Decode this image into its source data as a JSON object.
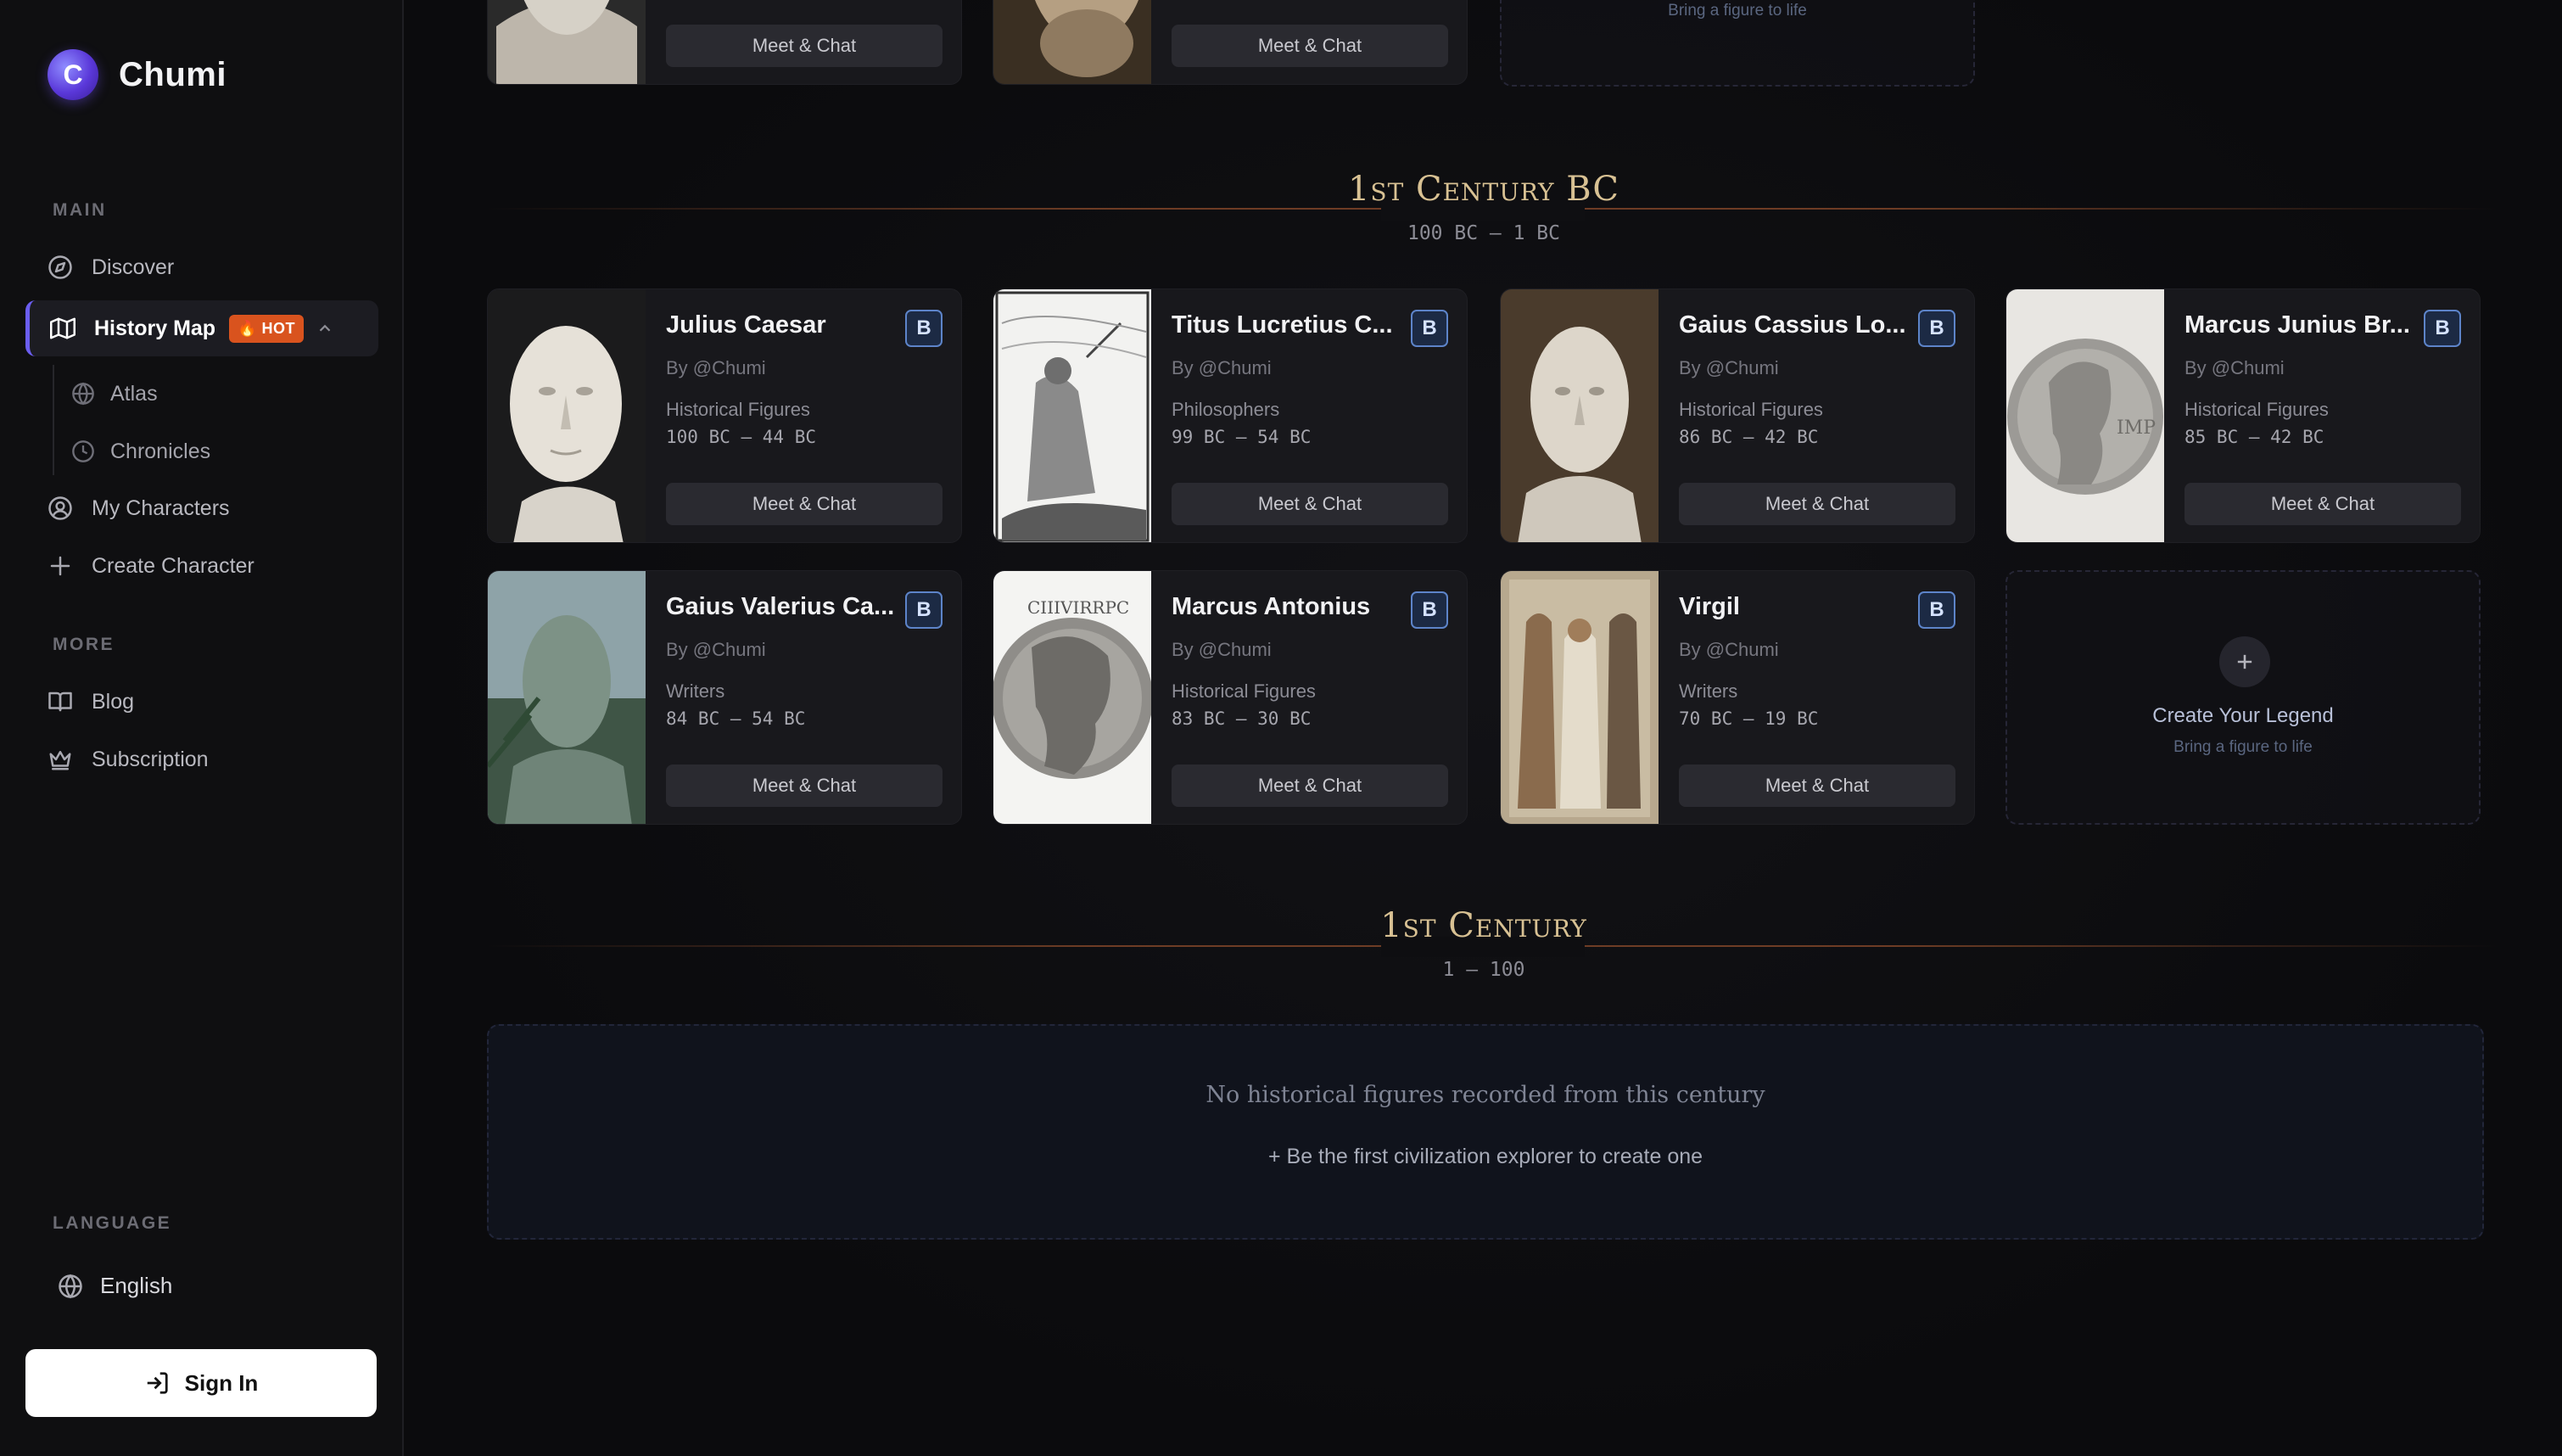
{
  "app": {
    "name": "Chumi",
    "logo_letter": "C",
    "accent": "#6b5ef0"
  },
  "sidebar": {
    "main_label": "MAIN",
    "discover": "Discover",
    "history_map": "History Map",
    "hot_badge": "🔥 HOT",
    "atlas": "Atlas",
    "chronicles": "Chronicles",
    "my_characters": "My Characters",
    "create_character": "Create Character",
    "more_label": "MORE",
    "blog": "Blog",
    "subscription": "Subscription",
    "language_label": "LANGUAGE",
    "language_value": "English",
    "sign_in": "Sign In"
  },
  "top_partial": {
    "cards": [
      {
        "button": "Meet & Chat"
      },
      {
        "button": "Meet & Chat"
      }
    ],
    "legend_sub": "Bring a figure to life"
  },
  "sections": [
    {
      "title": "1st Century BC",
      "range": "100 BC — 1 BC",
      "characters": [
        {
          "name": "Julius Caesar",
          "badge": "B",
          "author": "By @Chumi",
          "category": "Historical Figures",
          "dates": "100 BC — 44 BC",
          "button": "Meet & Chat"
        },
        {
          "name": "Titus Lucretius C...",
          "badge": "B",
          "author": "By @Chumi",
          "category": "Philosophers",
          "dates": "99 BC — 54 BC",
          "button": "Meet & Chat"
        },
        {
          "name": "Gaius Cassius Lo...",
          "badge": "B",
          "author": "By @Chumi",
          "category": "Historical Figures",
          "dates": "86 BC — 42 BC",
          "button": "Meet & Chat"
        },
        {
          "name": "Marcus Junius Br...",
          "badge": "B",
          "author": "By @Chumi",
          "category": "Historical Figures",
          "dates": "85 BC — 42 BC",
          "button": "Meet & Chat"
        },
        {
          "name": "Gaius Valerius Ca...",
          "badge": "B",
          "author": "By @Chumi",
          "category": "Writers",
          "dates": "84 BC — 54 BC",
          "button": "Meet & Chat"
        },
        {
          "name": "Marcus Antonius",
          "badge": "B",
          "author": "By @Chumi",
          "category": "Historical Figures",
          "dates": "83 BC — 30 BC",
          "button": "Meet & Chat"
        },
        {
          "name": "Virgil",
          "badge": "B",
          "author": "By @Chumi",
          "category": "Writers",
          "dates": "70 BC — 19 BC",
          "button": "Meet & Chat"
        }
      ],
      "legend": {
        "title": "Create Your Legend",
        "sub": "Bring a figure to life"
      }
    },
    {
      "title": "1st Century",
      "range": "1 — 100",
      "empty_text": "No historical figures recorded from this century",
      "empty_link": "+  Be the first civilization explorer to create one"
    }
  ]
}
